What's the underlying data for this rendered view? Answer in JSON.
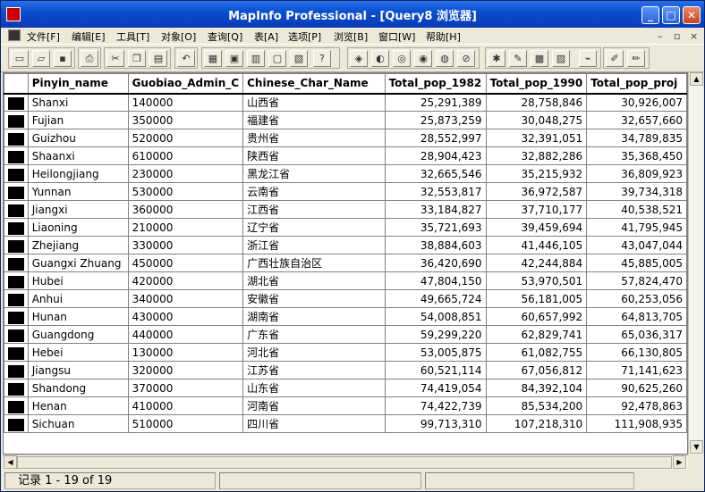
{
  "window": {
    "title": "MapInfo Professional - [Query8 浏览器]",
    "controls": {
      "minimize": "_",
      "maximize": "□",
      "close": "✕"
    }
  },
  "menu": {
    "items": [
      "文件[F]",
      "编辑[E]",
      "工具[T]",
      "对象[O]",
      "查询[Q]",
      "表[A]",
      "选项[P]",
      "浏览[B]",
      "窗口[W]",
      "帮助[H]"
    ],
    "mdi_controls": [
      "–",
      "▫",
      "×"
    ]
  },
  "toolbar": {
    "icons": [
      "new-icon",
      "open-icon",
      "save-icon",
      "print-icon",
      "cut-icon",
      "copy-icon",
      "paste-icon",
      "undo-icon",
      "browser-icon",
      "map-icon",
      "graph-icon",
      "layout-icon",
      "redistrict-icon",
      "help-pointer-icon",
      "layer-control-icon",
      "info-tool-icon",
      "hotlink-icon",
      "statistics-icon",
      "legend-icon",
      "disabled-icon",
      "run-program-icon",
      "tools-icon",
      "tile-icon",
      "ruler-icon",
      "mapbasic-icon",
      "pen-icon",
      "edit-icon"
    ]
  },
  "grid": {
    "columns": [
      "Pinyin_name",
      "Guobiao_Admin_C",
      "Chinese_Char_Name",
      "Total_pop_1982",
      "Total_pop_1990",
      "Total_pop_proj"
    ],
    "rows": [
      [
        "Shanxi",
        "140000",
        "山西省",
        "25,291,389",
        "28,758,846",
        "30,926,007"
      ],
      [
        "Fujian",
        "350000",
        "福建省",
        "25,873,259",
        "30,048,275",
        "32,657,660"
      ],
      [
        "Guizhou",
        "520000",
        "贵州省",
        "28,552,997",
        "32,391,051",
        "34,789,835"
      ],
      [
        "Shaanxi",
        "610000",
        "陕西省",
        "28,904,423",
        "32,882,286",
        "35,368,450"
      ],
      [
        "Heilongjiang",
        "230000",
        "黑龙江省",
        "32,665,546",
        "35,215,932",
        "36,809,923"
      ],
      [
        "Yunnan",
        "530000",
        "云南省",
        "32,553,817",
        "36,972,587",
        "39,734,318"
      ],
      [
        "Jiangxi",
        "360000",
        "江西省",
        "33,184,827",
        "37,710,177",
        "40,538,521"
      ],
      [
        "Liaoning",
        "210000",
        "辽宁省",
        "35,721,693",
        "39,459,694",
        "41,795,945"
      ],
      [
        "Zhejiang",
        "330000",
        "浙江省",
        "38,884,603",
        "41,446,105",
        "43,047,044"
      ],
      [
        "Guangxi Zhuang",
        "450000",
        "广西壮族自治区",
        "36,420,690",
        "42,244,884",
        "45,885,005"
      ],
      [
        "Hubei",
        "420000",
        "湖北省",
        "47,804,150",
        "53,970,501",
        "57,824,470"
      ],
      [
        "Anhui",
        "340000",
        "安徽省",
        "49,665,724",
        "56,181,005",
        "60,253,056"
      ],
      [
        "Hunan",
        "430000",
        "湖南省",
        "54,008,851",
        "60,657,992",
        "64,813,705"
      ],
      [
        "Guangdong",
        "440000",
        "广东省",
        "59,299,220",
        "62,829,741",
        "65,036,317"
      ],
      [
        "Hebei",
        "130000",
        "河北省",
        "53,005,875",
        "61,082,755",
        "66,130,805"
      ],
      [
        "Jiangsu",
        "320000",
        "江苏省",
        "60,521,114",
        "67,056,812",
        "71,141,623"
      ],
      [
        "Shandong",
        "370000",
        "山东省",
        "74,419,054",
        "84,392,104",
        "90,625,260"
      ],
      [
        "Henan",
        "410000",
        "河南省",
        "74,422,739",
        "85,534,200",
        "92,478,863"
      ],
      [
        "Sichuan",
        "510000",
        "四川省",
        "99,713,310",
        "107,218,310",
        "111,908,935"
      ]
    ]
  },
  "scroll": {
    "up": "▲",
    "down": "▼",
    "left": "◀",
    "right": "▶"
  },
  "status": {
    "record_text": "记录 1 - 19 of 19"
  }
}
